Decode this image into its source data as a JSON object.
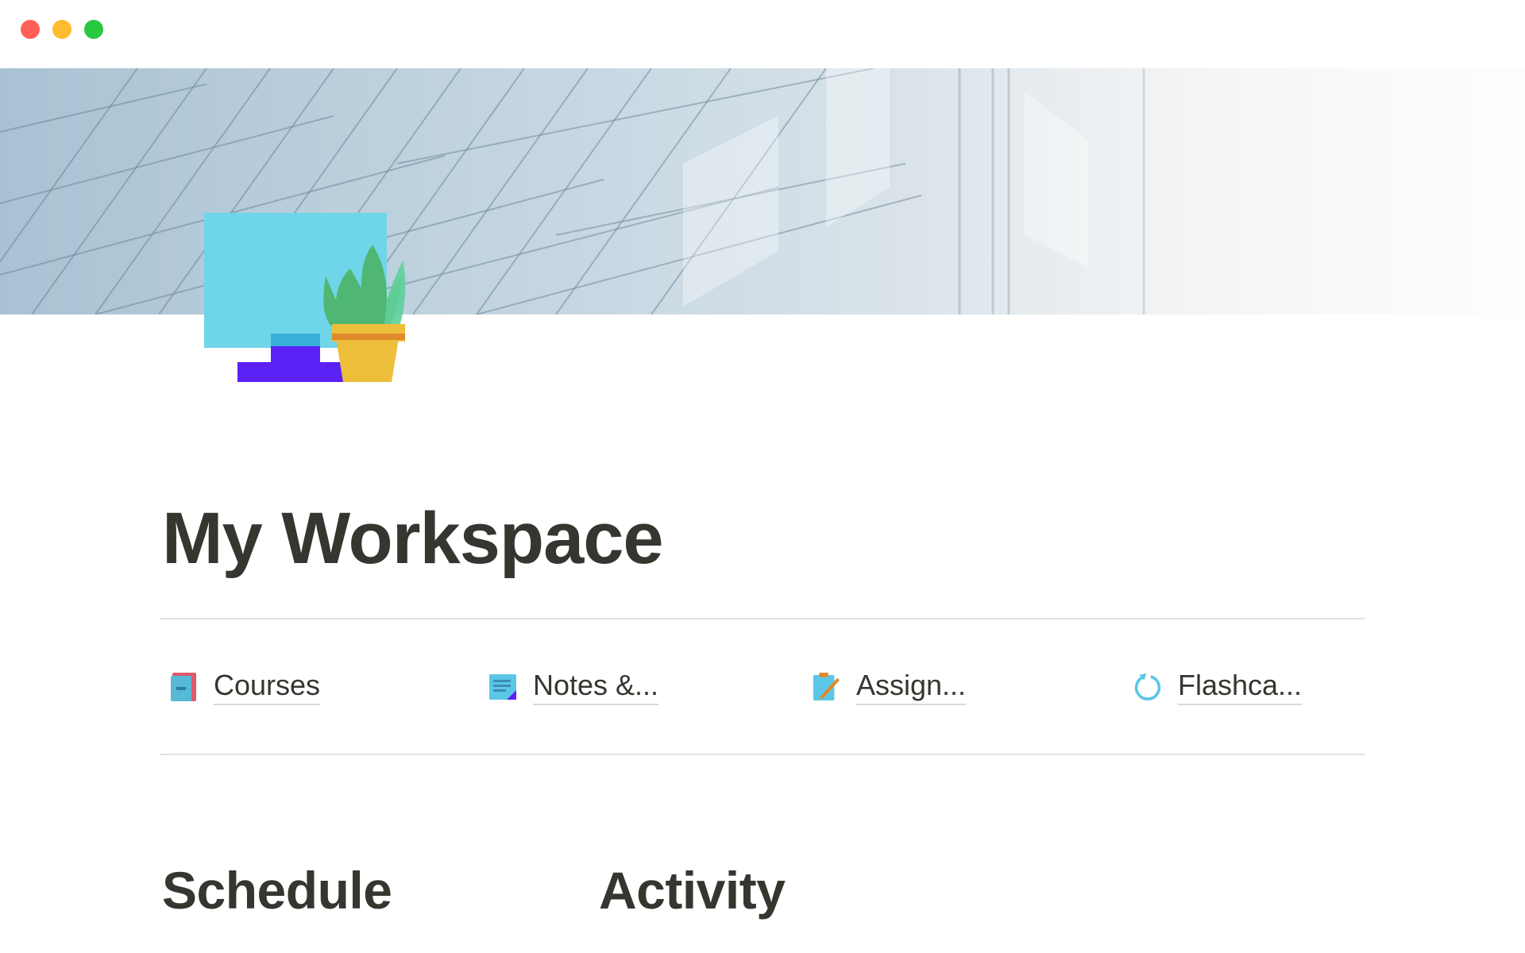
{
  "window": {
    "controls": [
      "close",
      "minimize",
      "zoom"
    ]
  },
  "cover": {
    "description_icon": "glass-building-cover-image"
  },
  "page": {
    "icon": "computer-plant-icon",
    "title": "My Workspace"
  },
  "links": [
    {
      "label": "Courses",
      "icon": "notebook-icon"
    },
    {
      "label": "Notes &...",
      "icon": "notes-icon"
    },
    {
      "label": "Assign...",
      "icon": "clipboard-pencil-icon"
    },
    {
      "label": "Flashca...",
      "icon": "refresh-icon"
    }
  ],
  "sections": {
    "schedule": "Schedule",
    "activity": "Activity"
  },
  "colors": {
    "title_text": "#37352f",
    "divider": "#e3e2e0",
    "close": "#ff5f57",
    "minimize": "#febc2e",
    "zoom": "#28c840"
  }
}
